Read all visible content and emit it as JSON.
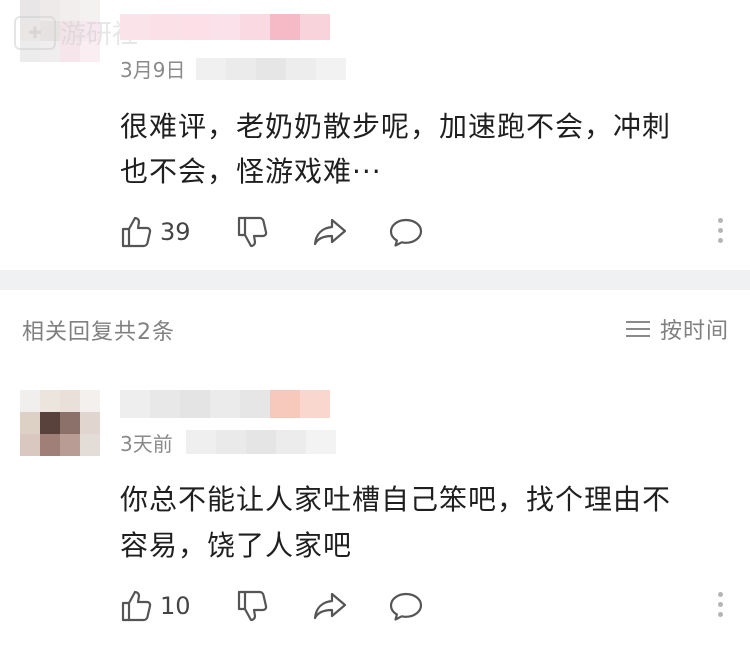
{
  "comments": [
    {
      "date": "3月9日",
      "text_line1": "很难评，老奶奶散步呢，加速跑不会，冲刺",
      "text_line2": "也不会，怪游戏难···",
      "likes": "39"
    },
    {
      "date": "3天前",
      "text_line1": "你总不能让人家吐槽自己笨吧，找个理由不",
      "text_line2": "容易，饶了人家吧",
      "likes": "10"
    }
  ],
  "replies_header": {
    "title": "相关回复共2条",
    "sort_label": "按时间"
  },
  "watermark": {
    "text": "游研社"
  },
  "icons": {
    "like": "thumbs-up-icon",
    "dislike": "thumbs-down-icon",
    "share": "share-arrow-icon",
    "comment": "comment-bubble-icon",
    "more": "more-vertical-icon",
    "sort": "sort-lines-icon"
  }
}
